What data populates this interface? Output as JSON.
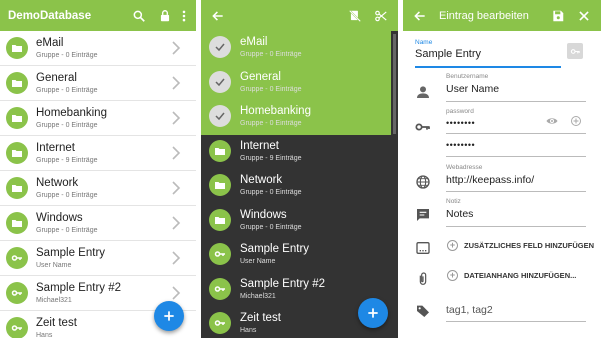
{
  "colors": {
    "accent": "#8bc34a",
    "fab": "#1e88e5",
    "dark": "#333333"
  },
  "panel_list": {
    "title": "DemoDatabase",
    "icons": [
      "search-icon",
      "lock-icon",
      "more-vert-icon"
    ],
    "rows": [
      {
        "title": "eMail",
        "subtitle": "Gruppe - 0 Einträge",
        "icon": "folder-icon"
      },
      {
        "title": "General",
        "subtitle": "Gruppe - 0 Einträge",
        "icon": "folder-icon"
      },
      {
        "title": "Homebanking",
        "subtitle": "Gruppe - 0 Einträge",
        "icon": "folder-icon"
      },
      {
        "title": "Internet",
        "subtitle": "Gruppe - 9 Einträge",
        "icon": "folder-icon"
      },
      {
        "title": "Network",
        "subtitle": "Gruppe - 0 Einträge",
        "icon": "folder-icon"
      },
      {
        "title": "Windows",
        "subtitle": "Gruppe - 0 Einträge",
        "icon": "folder-icon"
      },
      {
        "title": "Sample Entry",
        "subtitle": "User Name",
        "icon": "key-icon"
      },
      {
        "title": "Sample Entry #2",
        "subtitle": "Michael321",
        "icon": "key-icon"
      },
      {
        "title": "Zeit test",
        "subtitle": "Hans",
        "icon": "key-icon"
      }
    ]
  },
  "panel_select": {
    "icons": [
      "back-arrow-icon",
      "no-copy-icon",
      "cut-icon"
    ],
    "rows": [
      {
        "title": "eMail",
        "subtitle": "Gruppe - 0 Einträge",
        "selected": true
      },
      {
        "title": "General",
        "subtitle": "Gruppe - 0 Einträge",
        "selected": true
      },
      {
        "title": "Homebanking",
        "subtitle": "Gruppe - 0 Einträge",
        "selected": true
      },
      {
        "title": "Internet",
        "subtitle": "Gruppe - 9 Einträge",
        "selected": false
      },
      {
        "title": "Network",
        "subtitle": "Gruppe - 0 Einträge",
        "selected": false
      },
      {
        "title": "Windows",
        "subtitle": "Gruppe - 0 Einträge",
        "selected": false
      },
      {
        "title": "Sample Entry",
        "subtitle": "User Name",
        "selected": false
      },
      {
        "title": "Sample Entry #2",
        "subtitle": "Michael321",
        "selected": false
      },
      {
        "title": "Zeit test",
        "subtitle": "Hans",
        "selected": false
      }
    ]
  },
  "panel_edit": {
    "title": "Eintrag bearbeiten",
    "name_label": "Name",
    "name_value": "Sample Entry",
    "user_label": "Benutzername",
    "user_value": "User Name",
    "password_label": "password",
    "password_value": "••••••••",
    "password_confirm": "••••••••",
    "url_label": "Webadresse",
    "url_value": "http://keepass.info/",
    "notes_label": "Notiz",
    "notes_value": "Notes",
    "add_field": "ZUSÄTZLICHES FELD HINZUFÜGEN",
    "add_attachment": "DATEIANHANG HINZUFÜGEN...",
    "tags_value": "tag1, tag2"
  }
}
